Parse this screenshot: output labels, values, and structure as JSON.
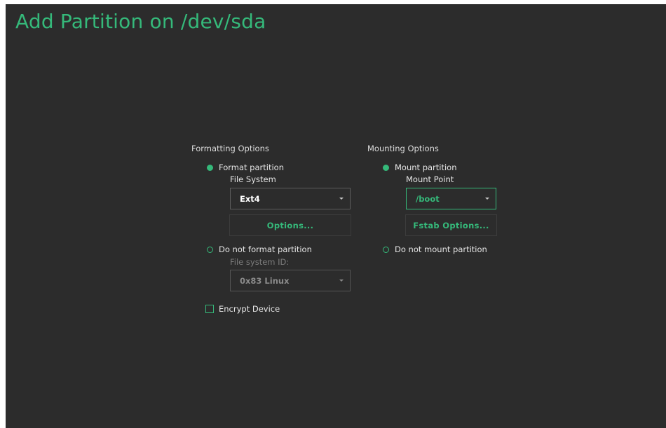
{
  "window": {
    "title": "Add Partition on /dev/sda"
  },
  "formatting": {
    "section_title": "Formatting Options",
    "format_radio_label": "Format partition",
    "filesystem_label": "File System",
    "filesystem_value": "Ext4",
    "options_button": "Options...",
    "no_format_radio_label": "Do not format partition",
    "fs_id_label": "File system ID:",
    "fs_id_value": "0x83 Linux",
    "encrypt_label": "Encrypt Device",
    "encrypt_checked": false,
    "selected": "format"
  },
  "mounting": {
    "section_title": "Mounting Options",
    "mount_radio_label": "Mount partition",
    "mount_point_label": "Mount Point",
    "mount_point_value": "/boot",
    "fstab_button": "Fstab Options...",
    "no_mount_radio_label": "Do not mount partition",
    "selected": "mount"
  },
  "colors": {
    "accent": "#35b97a",
    "background": "#2c2c2c",
    "text": "#e6e6e6",
    "disabled_text": "#7c7c7c"
  }
}
